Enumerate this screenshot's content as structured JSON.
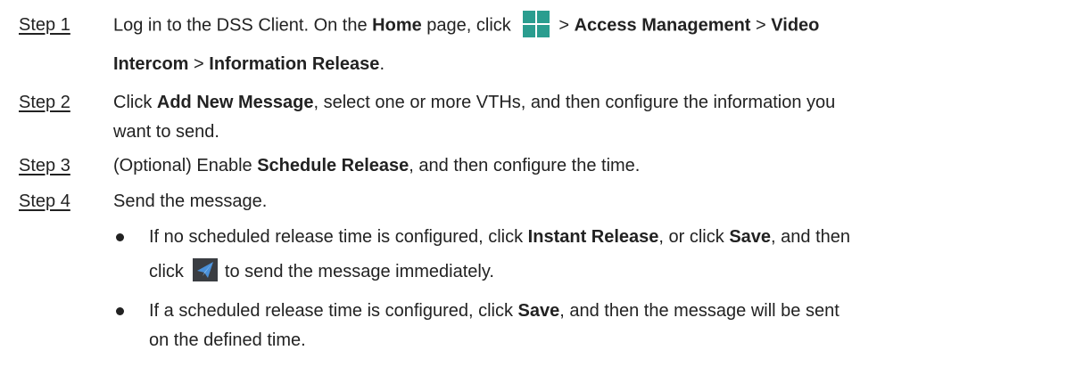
{
  "steps": [
    {
      "label": "Step 1",
      "lines": [
        [
          "Log in to the DSS Client. On the ",
          "Home",
          " page, click ",
          "> ",
          "Access Management",
          " > ",
          "Video"
        ],
        [
          "Intercom",
          " > ",
          "Information Release",
          "."
        ]
      ]
    },
    {
      "label": "Step 2",
      "lines": [
        [
          "Click ",
          "Add New Message",
          ", select one or more VTHs, and then configure the information you"
        ],
        [
          "want to send."
        ]
      ]
    },
    {
      "label": "Step 3",
      "lines": [
        [
          "(Optional) Enable ",
          "Schedule Release",
          ", and then configure the time."
        ]
      ]
    },
    {
      "label": "Step 4",
      "lines": [
        [
          "Send the message."
        ]
      ]
    }
  ],
  "bullets": [
    {
      "lines": [
        [
          "If no scheduled release time is configured, click ",
          "Instant Release",
          ", or click ",
          "Save",
          ", and then"
        ],
        [
          "click",
          "to send the message immediately."
        ]
      ]
    },
    {
      "lines": [
        [
          "If a scheduled release time is configured, click ",
          "Save",
          ", and then the message will be sent"
        ],
        [
          "on the defined time."
        ]
      ]
    }
  ],
  "icons": {
    "grid_icon_name": "grid-menu-icon",
    "grid_icon_color": "#2a9d8f",
    "send_icon_name": "send-message-icon",
    "send_icon_color": "#3a3d42"
  }
}
